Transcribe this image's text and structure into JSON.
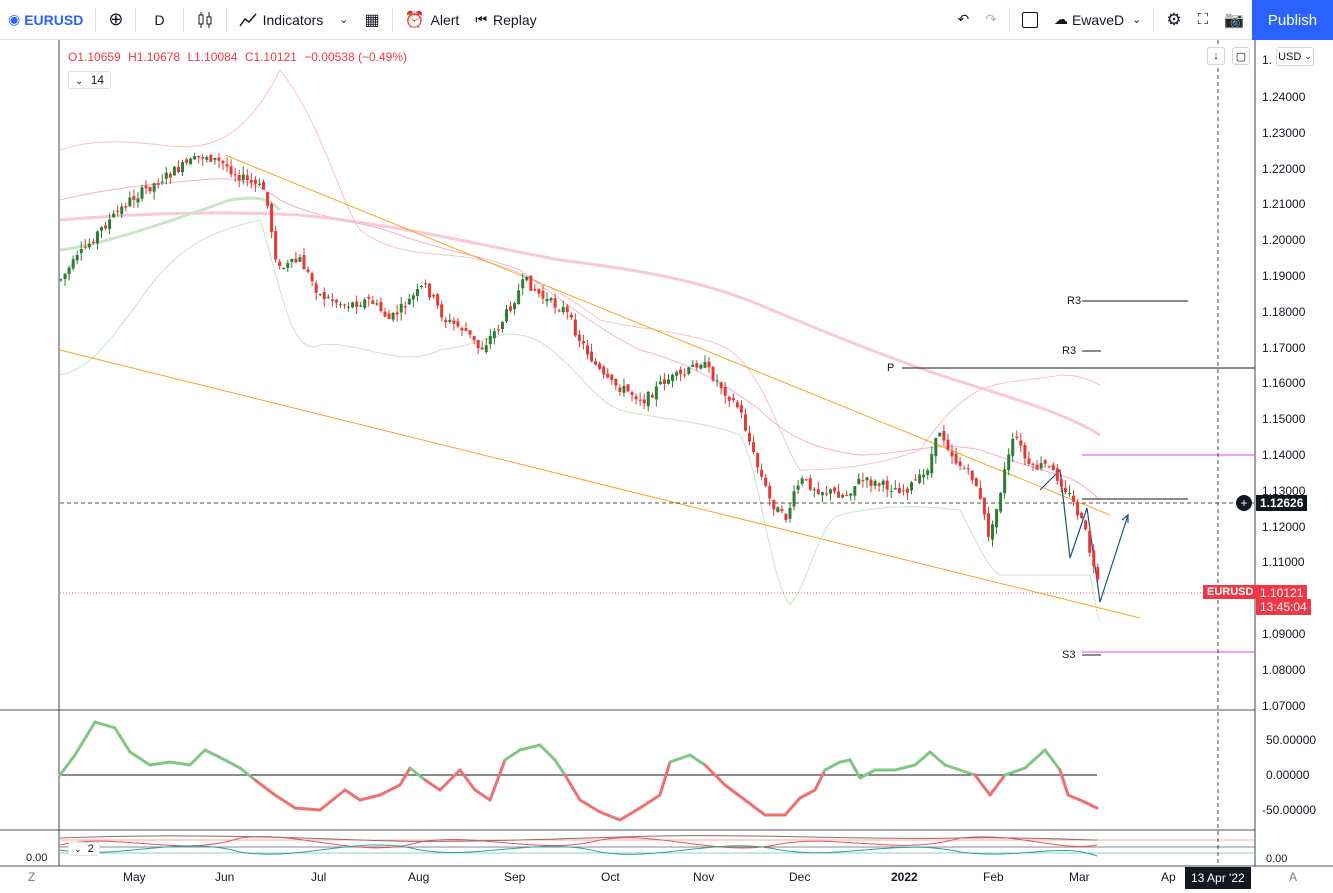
{
  "toolbar": {
    "symbol": "EURUSD",
    "interval": "D",
    "indicators": "Indicators",
    "alert": "Alert",
    "replay": "Replay",
    "layout_name": "EwaveD",
    "publish": "Publish"
  },
  "legend": {
    "open": "O1.10659",
    "high": "H1.10678",
    "low": "L1.10084",
    "close": "C1.10121",
    "change": "−0.00538 (−0.49%)",
    "ma_period": "14"
  },
  "currency": "USD",
  "price_axis": [
    "1.24000",
    "1.23000",
    "1.22000",
    "1.21000",
    "1.20000",
    "1.19000",
    "1.18000",
    "1.17000",
    "1.16000",
    "1.15000",
    "1.14000",
    "1.13000",
    "1.12000",
    "1.11000",
    "1.10000",
    "1.09000",
    "1.08000",
    "1.07000"
  ],
  "price_axis_top": "1.",
  "crosshair_price": "1.12626",
  "symbol_tag": "EURUSD",
  "last_price": "1.10121",
  "countdown": "13:45:04",
  "pivots": {
    "r3_a": "R3",
    "r3_b": "R3",
    "p": "P",
    "s3": "S3"
  },
  "osc_axis": [
    "50.00000",
    "0.00000",
    "-50.00000"
  ],
  "osc2_axis_left": "0.00",
  "osc2_axis_right": "0.00",
  "osc2_label": "2",
  "time_axis": [
    "May",
    "Jun",
    "Jul",
    "Aug",
    "Sep",
    "Oct",
    "Nov",
    "Dec",
    "2022",
    "Feb",
    "Mar",
    "Ap"
  ],
  "time_cursor": "13 Apr '22",
  "corner_left": "Z",
  "corner_right": "A",
  "colors": {
    "up": "#26a69a",
    "down": "#ef5350",
    "accent": "#2962ff",
    "channel": "#f5a623"
  }
}
